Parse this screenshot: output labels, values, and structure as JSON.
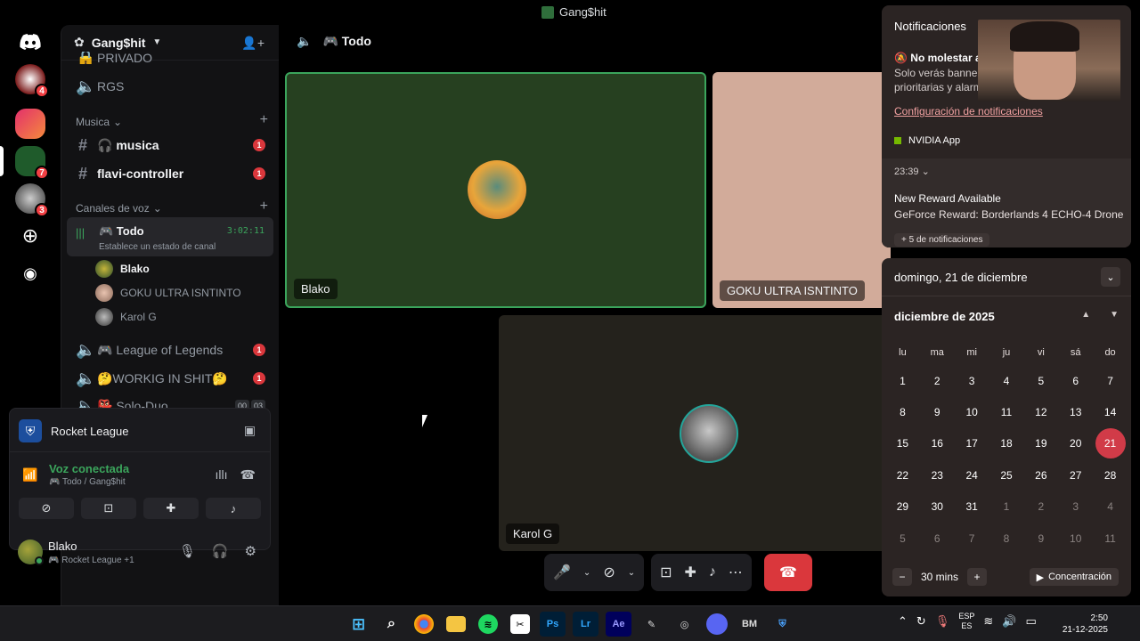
{
  "window": {
    "title": "Gang$hit"
  },
  "rail": {
    "badges": [
      "4",
      "7",
      "3"
    ]
  },
  "sidebar": {
    "guild_name": "Gang$hit",
    "partial_channel": "PRIVADO",
    "text_top": "RGS",
    "cat_musica": "Musica",
    "channels_text": [
      {
        "name": "🎧 musica",
        "badge": "1"
      },
      {
        "name": "flavi-controller",
        "badge": "1"
      }
    ],
    "cat_voz": "Canales de voz",
    "active_voice": {
      "name": "🎮 Todo",
      "timer": "3:02:11",
      "status": "Establece un estado de canal"
    },
    "voice_users": [
      "Blako",
      "GOKU ULTRA ISNTINTO",
      "Karol G"
    ],
    "voice_channels": [
      {
        "name": "🎮 League of Legends",
        "badge": "1"
      },
      {
        "name": "🤔WORKIG IN SHIT🤔",
        "badge": "1"
      },
      {
        "name": "👺 Solo-Duo",
        "badge_a": "00",
        "badge_b": "03"
      }
    ]
  },
  "activity": {
    "game": "Rocket League",
    "voice_status": "Voz conectada",
    "voice_sub": "🎮 Todo / Gang$hit"
  },
  "user": {
    "name": "Blako",
    "status": "🎮 Rocket League +1"
  },
  "call": {
    "channel": "🎮 Todo",
    "tiles": [
      "Blako",
      "GOKU ULTRA ISNTINTO",
      "Karol G"
    ]
  },
  "notifications": {
    "title": "Notificaciones",
    "dnd_title": "No molestar a",
    "dnd_desc": "Solo verás banner prioritarias y alarm",
    "settings_link": "Configuración de notificaciones",
    "app_name": "NVIDIA App",
    "time": "23:39",
    "reward_title": "New Reward Available",
    "reward_body": "GeForce Reward: Borderlands 4 ECHO-4 Drone",
    "more": "+ 5 de notificaciones"
  },
  "calendar": {
    "date_header": "domingo, 21 de diciembre",
    "month": "diciembre de 2025",
    "dow": [
      "lu",
      "ma",
      "mi",
      "ju",
      "vi",
      "sá",
      "do"
    ],
    "weeks": [
      [
        "1",
        "2",
        "3",
        "4",
        "5",
        "6",
        "7"
      ],
      [
        "8",
        "9",
        "10",
        "11",
        "12",
        "13",
        "14"
      ],
      [
        "15",
        "16",
        "17",
        "18",
        "19",
        "20",
        "21"
      ],
      [
        "22",
        "23",
        "24",
        "25",
        "26",
        "27",
        "28"
      ],
      [
        "29",
        "30",
        "31",
        "1",
        "2",
        "3",
        "4"
      ],
      [
        "5",
        "6",
        "7",
        "8",
        "9",
        "10",
        "11"
      ]
    ],
    "today": "21",
    "focus_minutes": "30 mins",
    "focus_label": "Concentración"
  },
  "taskbar": {
    "lang_1": "ESP",
    "lang_2": "ES",
    "time": "2:50",
    "date": "21-12-2025"
  }
}
